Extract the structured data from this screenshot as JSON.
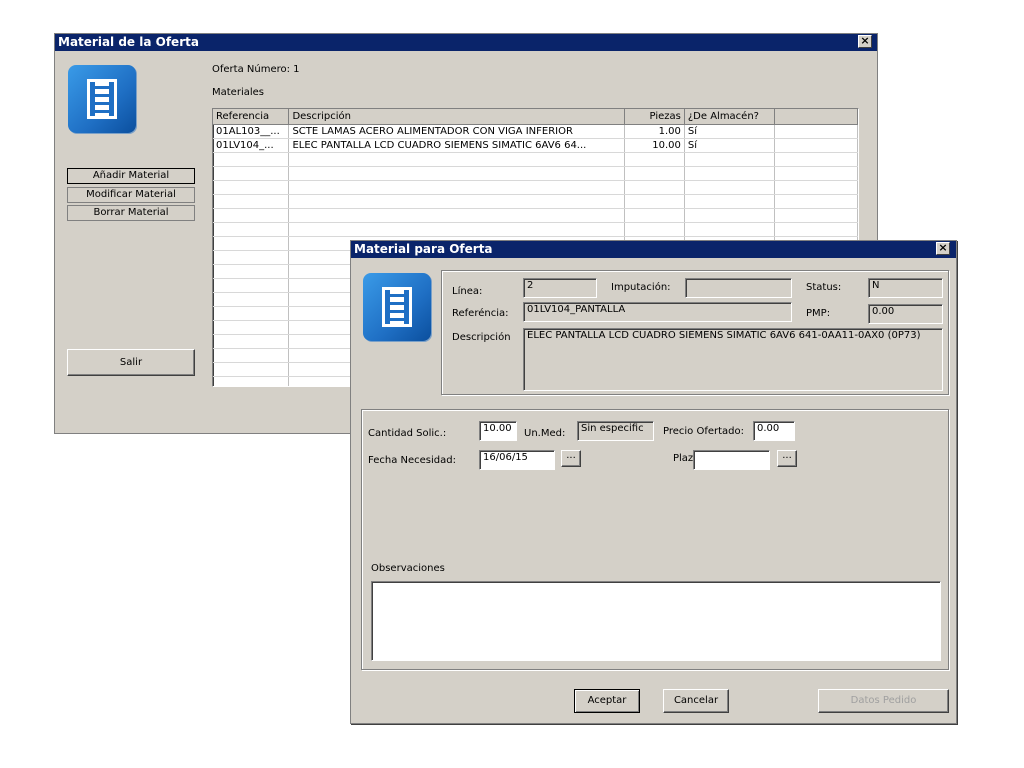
{
  "main_window": {
    "title": "Material de la Oferta",
    "close_glyph": "×",
    "offer_label": "Oferta Número: 1",
    "materials_label": "Materiales",
    "buttons": {
      "add": "Añadir Material",
      "modify": "Modificar Material",
      "delete": "Borrar Material",
      "exit": "Salir"
    },
    "table": {
      "headers": [
        "Referencia",
        "Descripción",
        "Piezas",
        "¿De Almacén?",
        ""
      ],
      "rows": [
        [
          "01AL103__...",
          "SCTE LAMAS ACERO ALIMENTADOR CON VIGA INFERIOR",
          "1.00",
          "Sí",
          ""
        ],
        [
          "01LV104_...",
          "ELEC PANTALLA LCD CUADRO SIEMENS SIMATIC 6AV6 64...",
          "10.00",
          "Sí",
          ""
        ]
      ]
    }
  },
  "dialog": {
    "title": "Material para Oferta",
    "close_glyph": "×",
    "linea_label": "Línea:",
    "linea_value": "2",
    "imputacion_label": "Imputación:",
    "imputacion_value": "",
    "status_label": "Status:",
    "status_value": "N",
    "referencia_label": "Referéncia:",
    "referencia_value": "01LV104_PANTALLA",
    "pmp_label": "PMP:",
    "pmp_value": "0.00",
    "descripcion_label": "Descripción",
    "descripcion_value": "ELEC PANTALLA LCD CUADRO SIEMENS SIMATIC 6AV6 641-0AA11-0AX0 (0P73)",
    "cantidad_label": "Cantidad Solic.:",
    "cantidad_value": "10.00",
    "unmed_label": "Un.Med:",
    "unmed_value": "Sin especific",
    "precio_label": "Precio Ofertado:",
    "precio_value": "0.00",
    "fecha_label": "Fecha Necesidad:",
    "fecha_value": "16/06/15",
    "plazo_label": "Plazo",
    "plazo_value": "",
    "ellipsis": "...",
    "observaciones_label": "Observaciones",
    "observaciones_value": "",
    "buttons": {
      "accept": "Aceptar",
      "cancel": "Cancelar",
      "order_data": "Datos Pedido"
    }
  },
  "colors": {
    "titlebar": "#0a246a",
    "face": "#d4d0c8",
    "icon_blue": "#1f6fc4"
  },
  "icons": [
    "ladder-icon",
    "close-icon"
  ]
}
